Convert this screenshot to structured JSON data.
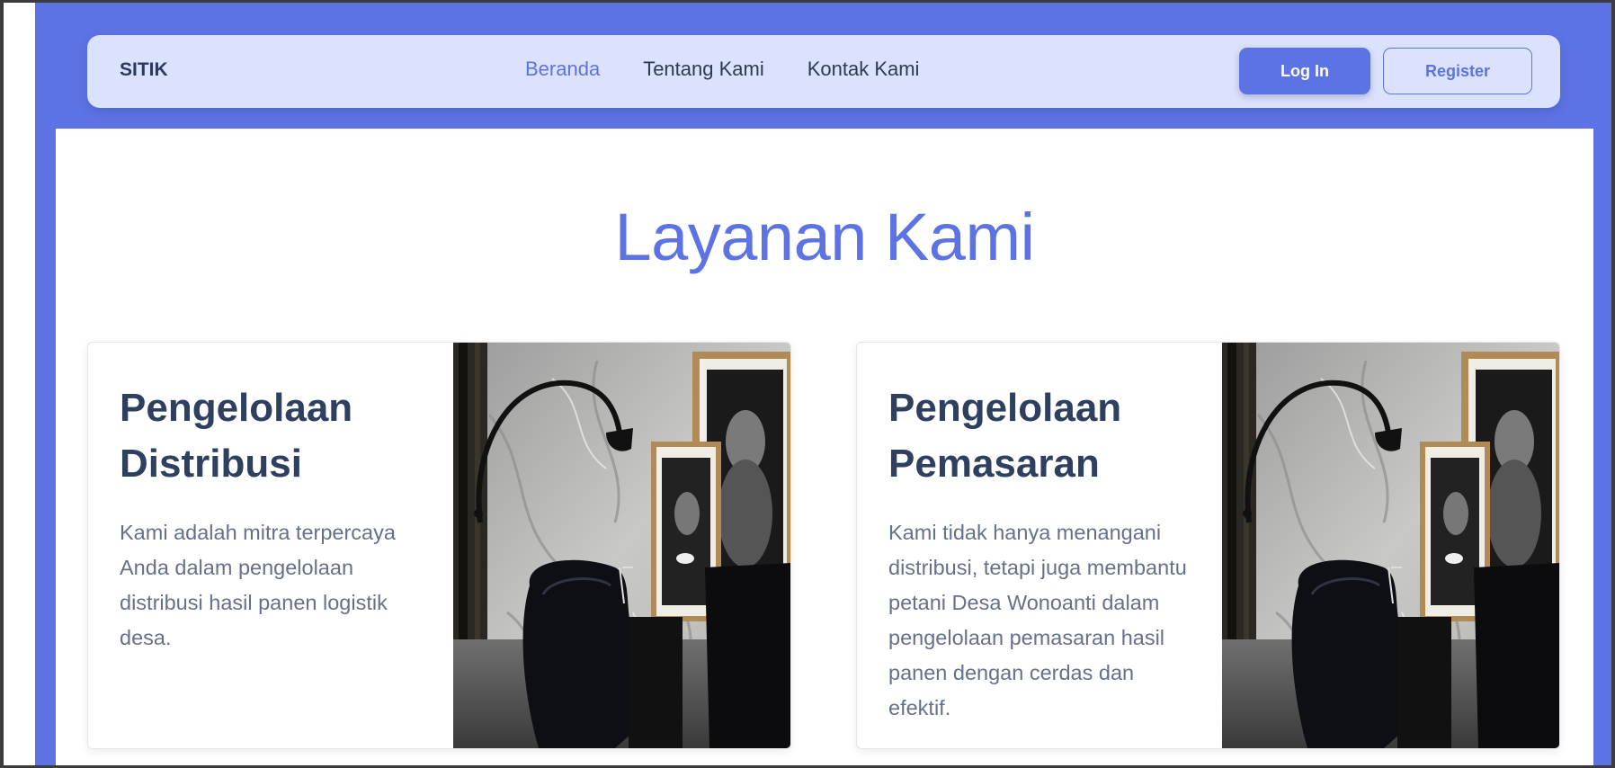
{
  "navbar": {
    "brand": "SITIK",
    "links": [
      {
        "label": "Beranda",
        "active": true
      },
      {
        "label": "Tentang Kami",
        "active": false
      },
      {
        "label": "Kontak Kami",
        "active": false
      }
    ],
    "login_label": "Log In",
    "register_label": "Register"
  },
  "services": {
    "title": "Layanan Kami",
    "cards": [
      {
        "title_line1": "Pengelolaan",
        "title_line2": "Distribusi",
        "description": "Kami adalah mitra terpercaya Anda dalam pengelolaan distribusi hasil panen logistik desa."
      },
      {
        "title_line1": "Pengelolaan",
        "title_line2": "Pemasaran",
        "description": "Kami tidak hanya menangani distribusi, tetapi juga membantu petani Desa Wonoanti dalam pengelolaan pemasaran hasil panen dengan cerdas dan efektif."
      }
    ]
  },
  "colors": {
    "accent": "#5e73e3",
    "navbar_bg": "#dbe2fd",
    "heading": "#2e3f60",
    "body_text": "#66708a"
  }
}
